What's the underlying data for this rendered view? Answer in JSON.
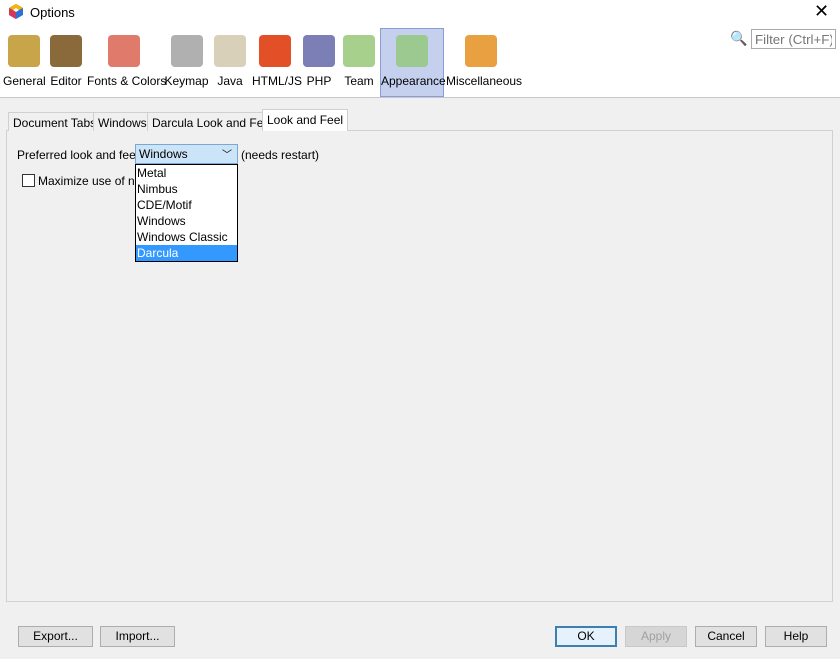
{
  "window": {
    "title": "Options",
    "close": "✕"
  },
  "search": {
    "placeholder": "Filter (Ctrl+F)"
  },
  "categories": [
    {
      "label": "General",
      "icon": "gear-wrench-icon",
      "color": "#c9a54a"
    },
    {
      "label": "Editor",
      "icon": "book-pencil-icon",
      "color": "#8a6a3a"
    },
    {
      "label": "Fonts & Colors",
      "icon": "fonts-colors-icon",
      "color": "#e07a6a"
    },
    {
      "label": "Keymap",
      "icon": "keyboard-icon",
      "color": "#b0b0b0"
    },
    {
      "label": "Java",
      "icon": "coffee-cup-icon",
      "color": "#d8d0b8"
    },
    {
      "label": "HTML/JS",
      "icon": "html5-icon",
      "color": "#e34f26"
    },
    {
      "label": "PHP",
      "icon": "php-icon",
      "color": "#7b7fb5"
    },
    {
      "label": "Team",
      "icon": "cubes-icon",
      "color": "#a8d08d"
    },
    {
      "label": "Appearance",
      "icon": "appearance-icon",
      "color": "#9bc98f"
    },
    {
      "label": "Miscellaneous",
      "icon": "folder-gear-icon",
      "color": "#e8a040"
    }
  ],
  "selected_category": "Appearance",
  "tabs": [
    "Document Tabs",
    "Windows",
    "Darcula Look and Feel",
    "Look and Feel"
  ],
  "selected_tab": "Look and Feel",
  "form": {
    "pref_label": "Preferred look and feel:",
    "combo_value": "Windows",
    "needs_restart": "(needs restart)",
    "checkbox_label": "Maximize use of nati",
    "checkbox_checked": false,
    "options": [
      "Metal",
      "Nimbus",
      "CDE/Motif",
      "Windows",
      "Windows Classic",
      "Darcula"
    ],
    "highlighted_option": "Darcula"
  },
  "buttons": {
    "export": "Export...",
    "import": "Import...",
    "ok": "OK",
    "apply": "Apply",
    "cancel": "Cancel",
    "help": "Help"
  }
}
